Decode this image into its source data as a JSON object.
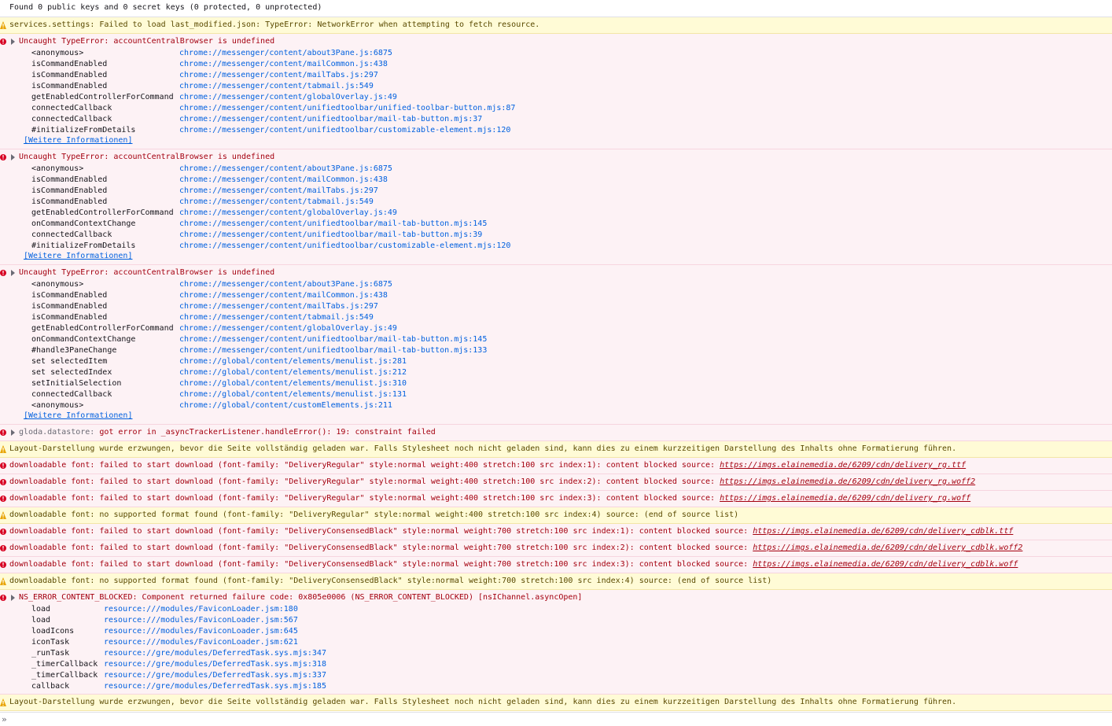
{
  "colors": {
    "error_bg": "#fdf2f5",
    "warn_bg": "#fffbd6",
    "link": "#0060df",
    "error_text": "#a4000f"
  },
  "messages": {
    "m0": {
      "text": "Found 0 public keys and 0 secret keys (0 protected, 0 unprotected)"
    },
    "m1": {
      "text": "services.settings: Failed to load last_modified.json: TypeError: NetworkError when attempting to fetch resource."
    },
    "m2": {
      "text": "Uncaught TypeError: accountCentralBrowser is undefined",
      "frames": [
        {
          "fn": "<anonymous>",
          "src": "chrome://messenger/content/about3Pane.js:6875"
        },
        {
          "fn": "isCommandEnabled",
          "src": "chrome://messenger/content/mailCommon.js:438"
        },
        {
          "fn": "isCommandEnabled",
          "src": "chrome://messenger/content/mailTabs.js:297"
        },
        {
          "fn": "isCommandEnabled",
          "src": "chrome://messenger/content/tabmail.js:549"
        },
        {
          "fn": "getEnabledControllerForCommand",
          "src": "chrome://messenger/content/globalOverlay.js:49"
        },
        {
          "fn": "connectedCallback",
          "src": "chrome://messenger/content/unifiedtoolbar/unified-toolbar-button.mjs:87"
        },
        {
          "fn": "connectedCallback",
          "src": "chrome://messenger/content/unifiedtoolbar/mail-tab-button.mjs:37"
        },
        {
          "fn": "#initializeFromDetails",
          "src": "chrome://messenger/content/unifiedtoolbar/customizable-element.mjs:120"
        }
      ],
      "learn_more": "[Weitere Informationen]"
    },
    "m3": {
      "text": "Uncaught TypeError: accountCentralBrowser is undefined",
      "frames": [
        {
          "fn": "<anonymous>",
          "src": "chrome://messenger/content/about3Pane.js:6875"
        },
        {
          "fn": "isCommandEnabled",
          "src": "chrome://messenger/content/mailCommon.js:438"
        },
        {
          "fn": "isCommandEnabled",
          "src": "chrome://messenger/content/mailTabs.js:297"
        },
        {
          "fn": "isCommandEnabled",
          "src": "chrome://messenger/content/tabmail.js:549"
        },
        {
          "fn": "getEnabledControllerForCommand",
          "src": "chrome://messenger/content/globalOverlay.js:49"
        },
        {
          "fn": "onCommandContextChange",
          "src": "chrome://messenger/content/unifiedtoolbar/mail-tab-button.mjs:145"
        },
        {
          "fn": "connectedCallback",
          "src": "chrome://messenger/content/unifiedtoolbar/mail-tab-button.mjs:39"
        },
        {
          "fn": "#initializeFromDetails",
          "src": "chrome://messenger/content/unifiedtoolbar/customizable-element.mjs:120"
        }
      ],
      "learn_more": "[Weitere Informationen]"
    },
    "m4": {
      "text": "Uncaught TypeError: accountCentralBrowser is undefined",
      "frames": [
        {
          "fn": "<anonymous>",
          "src": "chrome://messenger/content/about3Pane.js:6875"
        },
        {
          "fn": "isCommandEnabled",
          "src": "chrome://messenger/content/mailCommon.js:438"
        },
        {
          "fn": "isCommandEnabled",
          "src": "chrome://messenger/content/mailTabs.js:297"
        },
        {
          "fn": "isCommandEnabled",
          "src": "chrome://messenger/content/tabmail.js:549"
        },
        {
          "fn": "getEnabledControllerForCommand",
          "src": "chrome://messenger/content/globalOverlay.js:49"
        },
        {
          "fn": "onCommandContextChange",
          "src": "chrome://messenger/content/unifiedtoolbar/mail-tab-button.mjs:145"
        },
        {
          "fn": "#handle3PaneChange",
          "src": "chrome://messenger/content/unifiedtoolbar/mail-tab-button.mjs:133"
        },
        {
          "fn": "set selectedItem",
          "src": "chrome://global/content/elements/menulist.js:281"
        },
        {
          "fn": "set selectedIndex",
          "src": "chrome://global/content/elements/menulist.js:212"
        },
        {
          "fn": "setInitialSelection",
          "src": "chrome://global/content/elements/menulist.js:310"
        },
        {
          "fn": "connectedCallback",
          "src": "chrome://global/content/elements/menulist.js:131"
        },
        {
          "fn": "<anonymous>",
          "src": "chrome://global/content/customElements.js:211"
        }
      ],
      "learn_more": "[Weitere Informationen]"
    },
    "m5": {
      "prefix": "gloda.datastore:",
      "text": " got error in _asyncTrackerListener.handleError(): 19: constraint failed"
    },
    "m6": {
      "text": "Layout-Darstellung wurde erzwungen, bevor die Seite vollständig geladen war. Falls Stylesheet noch nicht geladen sind, kann dies zu einem kurzzeitigen Darstellung des Inhalts ohne Formatierung führen."
    },
    "m7": {
      "text": "downloadable font: failed to start download (font-family: \"DeliveryRegular\" style:normal weight:400 stretch:100 src index:1): content blocked source: ",
      "url": "https://imgs.elainemedia.de/6209/cdn/delivery_rg.ttf"
    },
    "m8": {
      "text": "downloadable font: failed to start download (font-family: \"DeliveryRegular\" style:normal weight:400 stretch:100 src index:2): content blocked source: ",
      "url": "https://imgs.elainemedia.de/6209/cdn/delivery_rg.woff2"
    },
    "m9": {
      "text": "downloadable font: failed to start download (font-family: \"DeliveryRegular\" style:normal weight:400 stretch:100 src index:3): content blocked source: ",
      "url": "https://imgs.elainemedia.de/6209/cdn/delivery_rg.woff"
    },
    "m10": {
      "text": "downloadable font: no supported format found (font-family: \"DeliveryRegular\" style:normal weight:400 stretch:100 src index:4) source: (end of source list)"
    },
    "m11": {
      "text": "downloadable font: failed to start download (font-family: \"DeliveryConsensedBlack\" style:normal weight:700 stretch:100 src index:1): content blocked source: ",
      "url": "https://imgs.elainemedia.de/6209/cdn/delivery_cdblk.ttf"
    },
    "m12": {
      "text": "downloadable font: failed to start download (font-family: \"DeliveryConsensedBlack\" style:normal weight:700 stretch:100 src index:2): content blocked source: ",
      "url": "https://imgs.elainemedia.de/6209/cdn/delivery_cdblk.woff2"
    },
    "m13": {
      "text": "downloadable font: failed to start download (font-family: \"DeliveryConsensedBlack\" style:normal weight:700 stretch:100 src index:3): content blocked source: ",
      "url": "https://imgs.elainemedia.de/6209/cdn/delivery_cdblk.woff"
    },
    "m14": {
      "text": "downloadable font: no supported format found (font-family: \"DeliveryConsensedBlack\" style:normal weight:700 stretch:100 src index:4) source: (end of source list)"
    },
    "m15": {
      "text": "NS_ERROR_CONTENT_BLOCKED: Component returned failure code: 0x805e0006 (NS_ERROR_CONTENT_BLOCKED) [nsIChannel.asyncOpen]",
      "frames": [
        {
          "fn": "load",
          "src": "resource:///modules/FaviconLoader.jsm:180"
        },
        {
          "fn": "load",
          "src": "resource:///modules/FaviconLoader.jsm:567"
        },
        {
          "fn": "loadIcons",
          "src": "resource:///modules/FaviconLoader.jsm:645"
        },
        {
          "fn": "iconTask",
          "src": "resource:///modules/FaviconLoader.jsm:621"
        },
        {
          "fn": "_runTask",
          "src": "resource://gre/modules/DeferredTask.sys.mjs:347"
        },
        {
          "fn": "_timerCallback",
          "src": "resource://gre/modules/DeferredTask.sys.mjs:318"
        },
        {
          "fn": "_timerCallback",
          "src": "resource://gre/modules/DeferredTask.sys.mjs:337"
        },
        {
          "fn": "callback",
          "src": "resource://gre/modules/DeferredTask.sys.mjs:185"
        }
      ]
    },
    "m16": {
      "text": "Layout-Darstellung wurde erzwungen, bevor die Seite vollständig geladen war. Falls Stylesheet noch nicht geladen sind, kann dies zu einem kurzzeitigen Darstellung des Inhalts ohne Formatierung führen."
    }
  },
  "input": {
    "prompt": "»",
    "value": " "
  }
}
